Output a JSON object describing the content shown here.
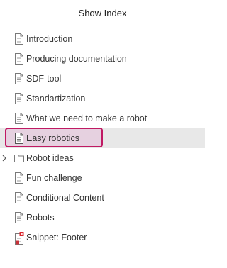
{
  "header": {
    "title": "Show Index"
  },
  "tree": {
    "items": [
      {
        "label": "Introduction",
        "icon": "document-icon"
      },
      {
        "label": "Producing documentation",
        "icon": "document-icon"
      },
      {
        "label": "SDF-tool",
        "icon": "document-icon"
      },
      {
        "label": "Standartization",
        "icon": "document-icon"
      },
      {
        "label": "What we need to make a robot",
        "icon": "document-icon"
      },
      {
        "label": "Easy robotics",
        "icon": "document-icon",
        "selected": true
      },
      {
        "label": "Robot ideas",
        "icon": "folder-icon",
        "expandable": true
      },
      {
        "label": "Fun challenge",
        "icon": "document-icon"
      },
      {
        "label": "Conditional Content",
        "icon": "document-icon"
      },
      {
        "label": "Robots",
        "icon": "document-icon"
      },
      {
        "label": "Snippet: Footer",
        "icon": "snippet-icon"
      }
    ]
  },
  "colors": {
    "selection_border": "#c01a63",
    "selection_fill": "#e6d1e0",
    "row_highlight": "#e8e8e8",
    "snippet_badge": "#d9262e"
  }
}
